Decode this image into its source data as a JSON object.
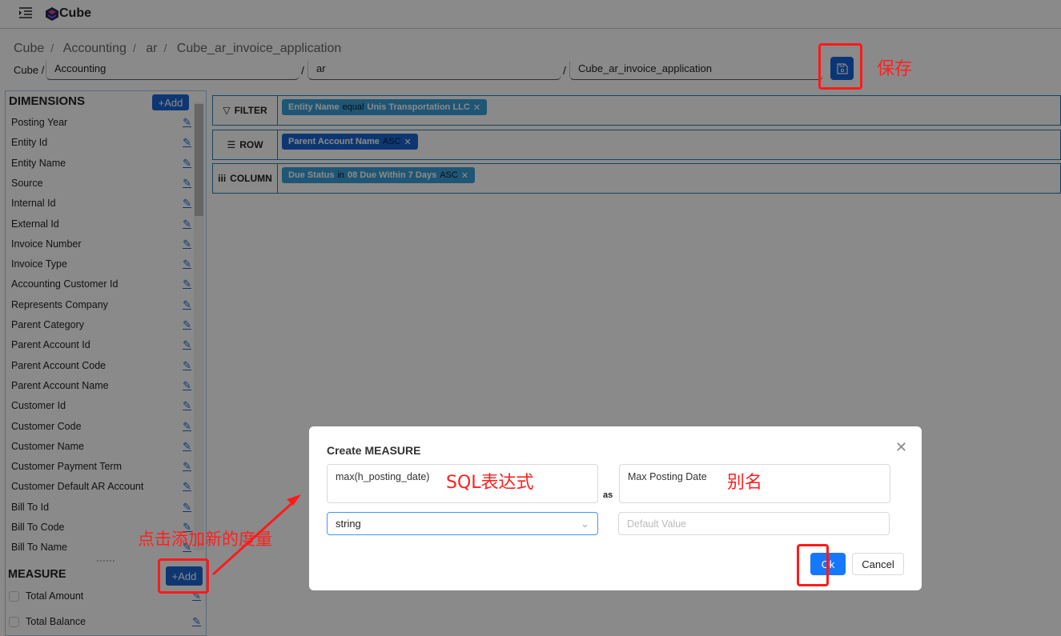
{
  "header": {
    "brand": "Cube"
  },
  "breadcrumb": [
    "Cube",
    "Accounting",
    "ar",
    "Cube_ar_invoice_application"
  ],
  "path": {
    "prefix": "Cube /",
    "folder": "Accounting",
    "sep": "/",
    "sub": "ar",
    "name": "Cube_ar_invoice_application"
  },
  "dimensions": {
    "title": "DIMENSIONS",
    "add_label": "+Add",
    "items": [
      "Posting Year",
      "Entity Id",
      "Entity Name",
      "Source",
      "Internal Id",
      "External Id",
      "Invoice Number",
      "Invoice Type",
      "Accounting Customer Id",
      "Represents Company",
      "Parent Category",
      "Parent Account Id",
      "Parent Account Code",
      "Parent Account Name",
      "Customer Id",
      "Customer Code",
      "Customer Name",
      "Customer Payment Term",
      "Customer Default AR Account",
      "Bill To Id",
      "Bill To Code",
      "Bill To Name"
    ]
  },
  "measure": {
    "title": "MEASURE",
    "add_label": "+Add",
    "items": [
      "Total Amount",
      "Total Balance"
    ]
  },
  "zones": {
    "filter": {
      "label": "FILTER",
      "tag": {
        "field": "Entity Name",
        "op": "equal",
        "value": "Unis Transportation LLC"
      }
    },
    "row": {
      "label": "ROW",
      "tag": {
        "field": "Parent Account Name",
        "order": "ASC"
      }
    },
    "column": {
      "label": "COLUMN",
      "tag": {
        "field": "Due Status",
        "op": "in",
        "value": "08 Due Within 7 Days",
        "order": "ASC"
      }
    }
  },
  "modal": {
    "title": "Create MEASURE",
    "expression": "max(h_posting_date)",
    "as_label": "as",
    "alias": "Max Posting Date",
    "type": "string",
    "default_placeholder": "Default Value",
    "ok_label": "Ok",
    "cancel_label": "Cancel"
  },
  "annotations": {
    "save": "保存",
    "sql": "SQL表达式",
    "alias": "别名",
    "add_measure": "点击添加新的度量"
  },
  "colors": {
    "primary": "#1a67d2",
    "annotation": "#ff1a1a",
    "tag": "#3aa0d8"
  }
}
